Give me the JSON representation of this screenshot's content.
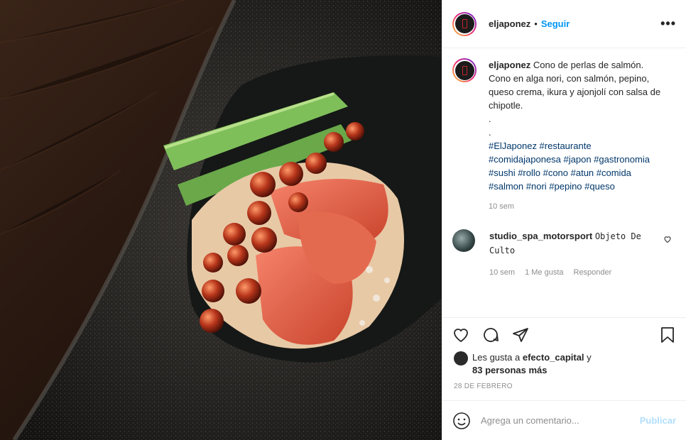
{
  "post": {
    "image_alt": "sushi-cone-photo",
    "author": {
      "username": "eljaponez",
      "separator": "•",
      "follow_label": "Seguir",
      "more_label": "•••"
    },
    "caption": {
      "username": "eljaponez",
      "text": "Cono de perlas de salmón. Cono en alga nori, con salmón, pepino, queso crema, ikura y ajonjolí con salsa de chipotle.",
      "dot1": ".",
      "dot2": ".",
      "hashtags": "#ElJaponez #restaurante #comidajaponesa #japon #gastronomia #sushi #rollo #cono #atun #comida #salmon #nori #pepino #queso",
      "time": "10 sem"
    },
    "comment": {
      "username": "studio_spa_motorsport",
      "text": "Objeto De Culto",
      "time": "10 sem",
      "likes": "1 Me gusta",
      "reply_label": "Responder"
    },
    "likes": {
      "prefix": "Les gusta a",
      "liker": "efecto_capital",
      "mid": "y",
      "others": "83 personas más"
    },
    "date": "28 DE FEBRERO",
    "add_comment": {
      "placeholder": "Agrega un comentario...",
      "publish_label": "Publicar"
    }
  },
  "colors": {
    "accent": "#0095f6",
    "publish_disabled": "#b2dffc",
    "hashtag": "#00376b",
    "muted": "#8e8e8e"
  }
}
